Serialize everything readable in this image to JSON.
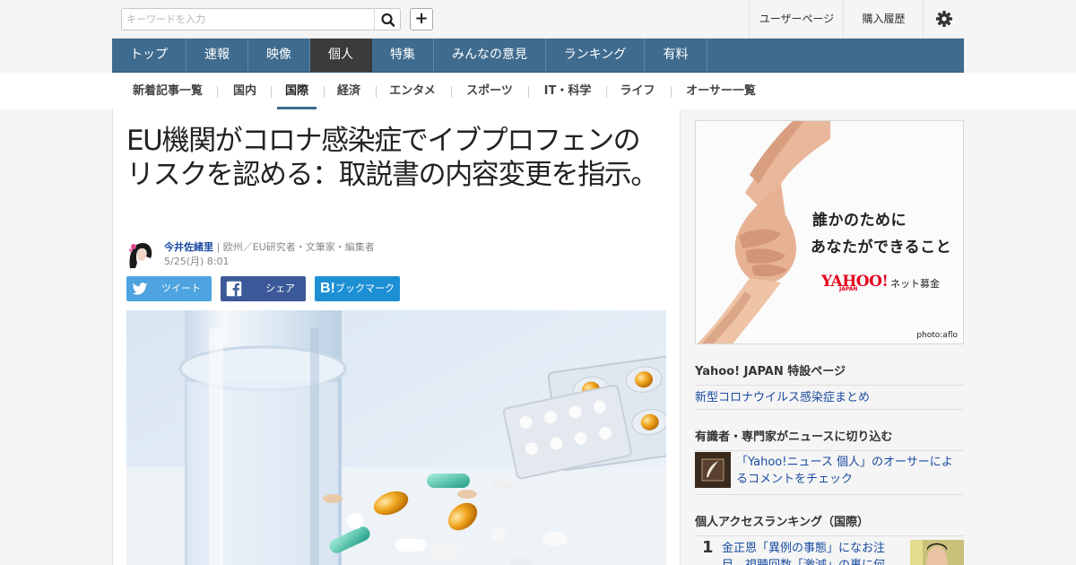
{
  "search": {
    "placeholder": "キーワードを入力"
  },
  "top_links": {
    "user_page": "ユーザーページ",
    "history": "購入履歴"
  },
  "icons": {
    "search": "search-icon",
    "add": "plus-icon",
    "settings": "gear-icon"
  },
  "main_nav": {
    "items": [
      {
        "label": "トップ"
      },
      {
        "label": "速報"
      },
      {
        "label": "映像"
      },
      {
        "label": "個人"
      },
      {
        "label": "特集"
      },
      {
        "label": "みんなの意見"
      },
      {
        "label": "ランキング"
      },
      {
        "label": "有料"
      }
    ],
    "active": "個人"
  },
  "sub_nav": {
    "items": [
      {
        "label": "新着記事一覧"
      },
      {
        "label": "国内"
      },
      {
        "label": "国際"
      },
      {
        "label": "経済"
      },
      {
        "label": "エンタメ"
      },
      {
        "label": "スポーツ"
      },
      {
        "label": "IT・科学"
      },
      {
        "label": "ライフ"
      },
      {
        "label": "オーサー一覧"
      }
    ],
    "active": "国際"
  },
  "article": {
    "title": "EU機関がコロナ感染症でイブプロフェンのリスクを認める：取説書の内容変更を指示。",
    "author": "今井佐緒里",
    "author_profile": " | 欧州／EU研究者・文筆家・編集者",
    "date": "5/25(月) 8:01",
    "share": {
      "tweet": "ツイート",
      "facebook": "シェア",
      "hatena": "ブックマーク"
    }
  },
  "sidebar": {
    "ad": {
      "line1": "誰かのために",
      "line2": "あなたができること",
      "logo": "YAHOO!",
      "logo_sub": "JAPAN",
      "tag": "ネット募金",
      "credit": "photo:aflo"
    },
    "special": {
      "heading": "Yahoo! JAPAN 特設ページ",
      "link": "新型コロナウイルス感染症まとめ"
    },
    "experts": {
      "heading": "有識者・専門家がニュースに切り込む",
      "link": "「Yahoo!ニュース 個人」のオーサーによるコメントをチェック"
    },
    "ranking": {
      "heading": "個人アクセスランキング（国際）",
      "items": [
        {
          "rank": "1",
          "title": "金正恩「異例の事態」になお注目…視聴回数「激減」の裏に何"
        }
      ]
    }
  },
  "colors": {
    "nav_bg": "#3f6b8e",
    "nav_active": "#3b3b3b",
    "link": "#1a4ba0",
    "twitter": "#4ea4e0",
    "facebook": "#3b5998",
    "hatena": "#1d8fd4"
  }
}
